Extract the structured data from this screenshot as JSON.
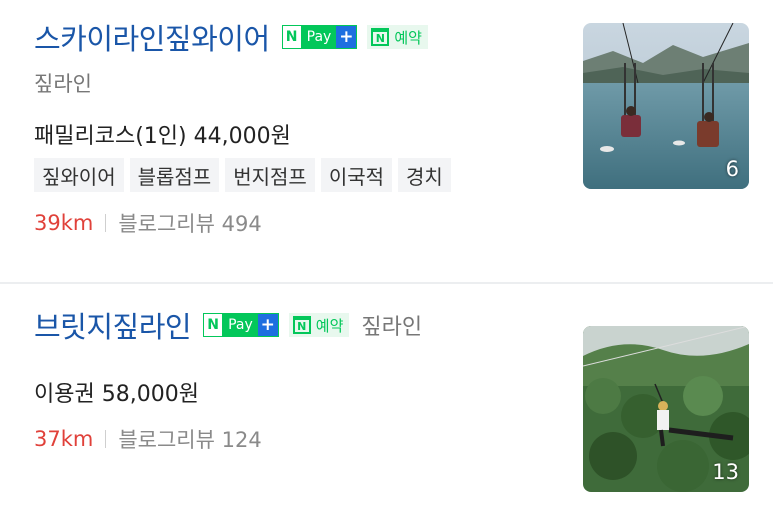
{
  "listings": [
    {
      "title": "스카이라인짚와이어",
      "badges": {
        "npay_n": "N",
        "npay_label": "Pay",
        "npay_plus": "+",
        "reserve_icon": "N",
        "reserve_label": "예약"
      },
      "category": "짚라인",
      "price": "패밀리코스(1인) 44,000원",
      "tags": [
        "짚와이어",
        "블롭점프",
        "번지점프",
        "이국적",
        "경치"
      ],
      "distance": "39km",
      "review": "블로그리뷰 494",
      "photo_count": "6"
    },
    {
      "title": "브릿지짚라인",
      "badges": {
        "npay_n": "N",
        "npay_label": "Pay",
        "npay_plus": "+",
        "reserve_icon": "N",
        "reserve_label": "예약"
      },
      "category": "짚라인",
      "price": "이용권 58,000원",
      "distance": "37km",
      "review": "블로그리뷰 124",
      "photo_count": "13"
    }
  ],
  "colors": {
    "title": "#1a56a8",
    "naver_green": "#03c75a",
    "plus_blue": "#1e6fe0",
    "distance": "#e0413a"
  }
}
